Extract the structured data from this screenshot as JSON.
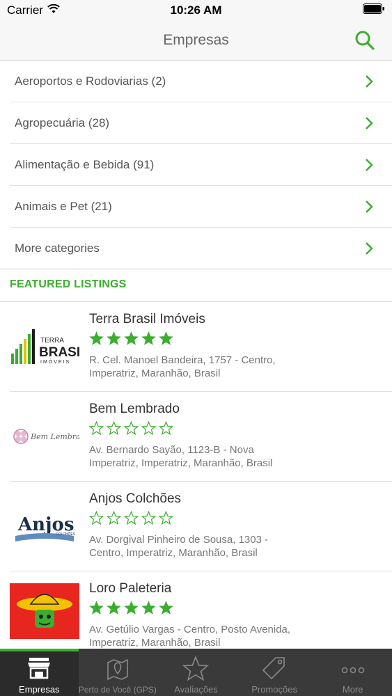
{
  "status_bar": {
    "carrier": "Carrier",
    "time": "10:26 AM"
  },
  "nav": {
    "title": "Empresas"
  },
  "categories": [
    {
      "label": "Aeroportos e Rodoviarias (2)"
    },
    {
      "label": "Agropecuária (28)"
    },
    {
      "label": "Alimentação e Bebida (91)"
    },
    {
      "label": "Animais e Pet (21)"
    },
    {
      "label": "More categories"
    }
  ],
  "featured": {
    "heading": "FEATURED LISTINGS",
    "items": [
      {
        "name": "Terra Brasil Imóveis",
        "rating": 5,
        "address": "R. Cel. Manoel Bandeira, 1757 - Centro, Imperatriz, Maranhão, Brasil",
        "logo_text": "TERRA BRASIL IMÓVEIS"
      },
      {
        "name": "Bem Lembrado",
        "rating": 0,
        "address": "Av. Bernardo Sayão, 1123-B - Nova Imperatriz, Imperatriz, Maranhão, Brasil",
        "logo_text": "Bem Lembrado"
      },
      {
        "name": "Anjos Colchões",
        "rating": 0,
        "address": "Av. Dorgival Pinheiro de Sousa, 1303 - Centro, Imperatriz, Maranhão, Brasil",
        "logo_text": "Anjos"
      },
      {
        "name": "Loro Paleteria",
        "rating": 5,
        "address": "Av. Getúlio Vargas - Centro, Posto Avenida, Imperatriz, Maranhão, Brasil",
        "logo_text": ""
      }
    ]
  },
  "tabs": [
    {
      "label": "Empresas",
      "icon": "store-icon",
      "active": true
    },
    {
      "label": "Perto de Você (GPS)",
      "icon": "map-pin-icon",
      "active": false
    },
    {
      "label": "Avaliações",
      "icon": "star-icon",
      "active": false
    },
    {
      "label": "Promoções",
      "icon": "tag-icon",
      "active": false
    },
    {
      "label": "More",
      "icon": "more-dots-icon",
      "active": false
    }
  ],
  "colors": {
    "accent": "#3cae2f",
    "tabbar": "#3a3a3a"
  }
}
